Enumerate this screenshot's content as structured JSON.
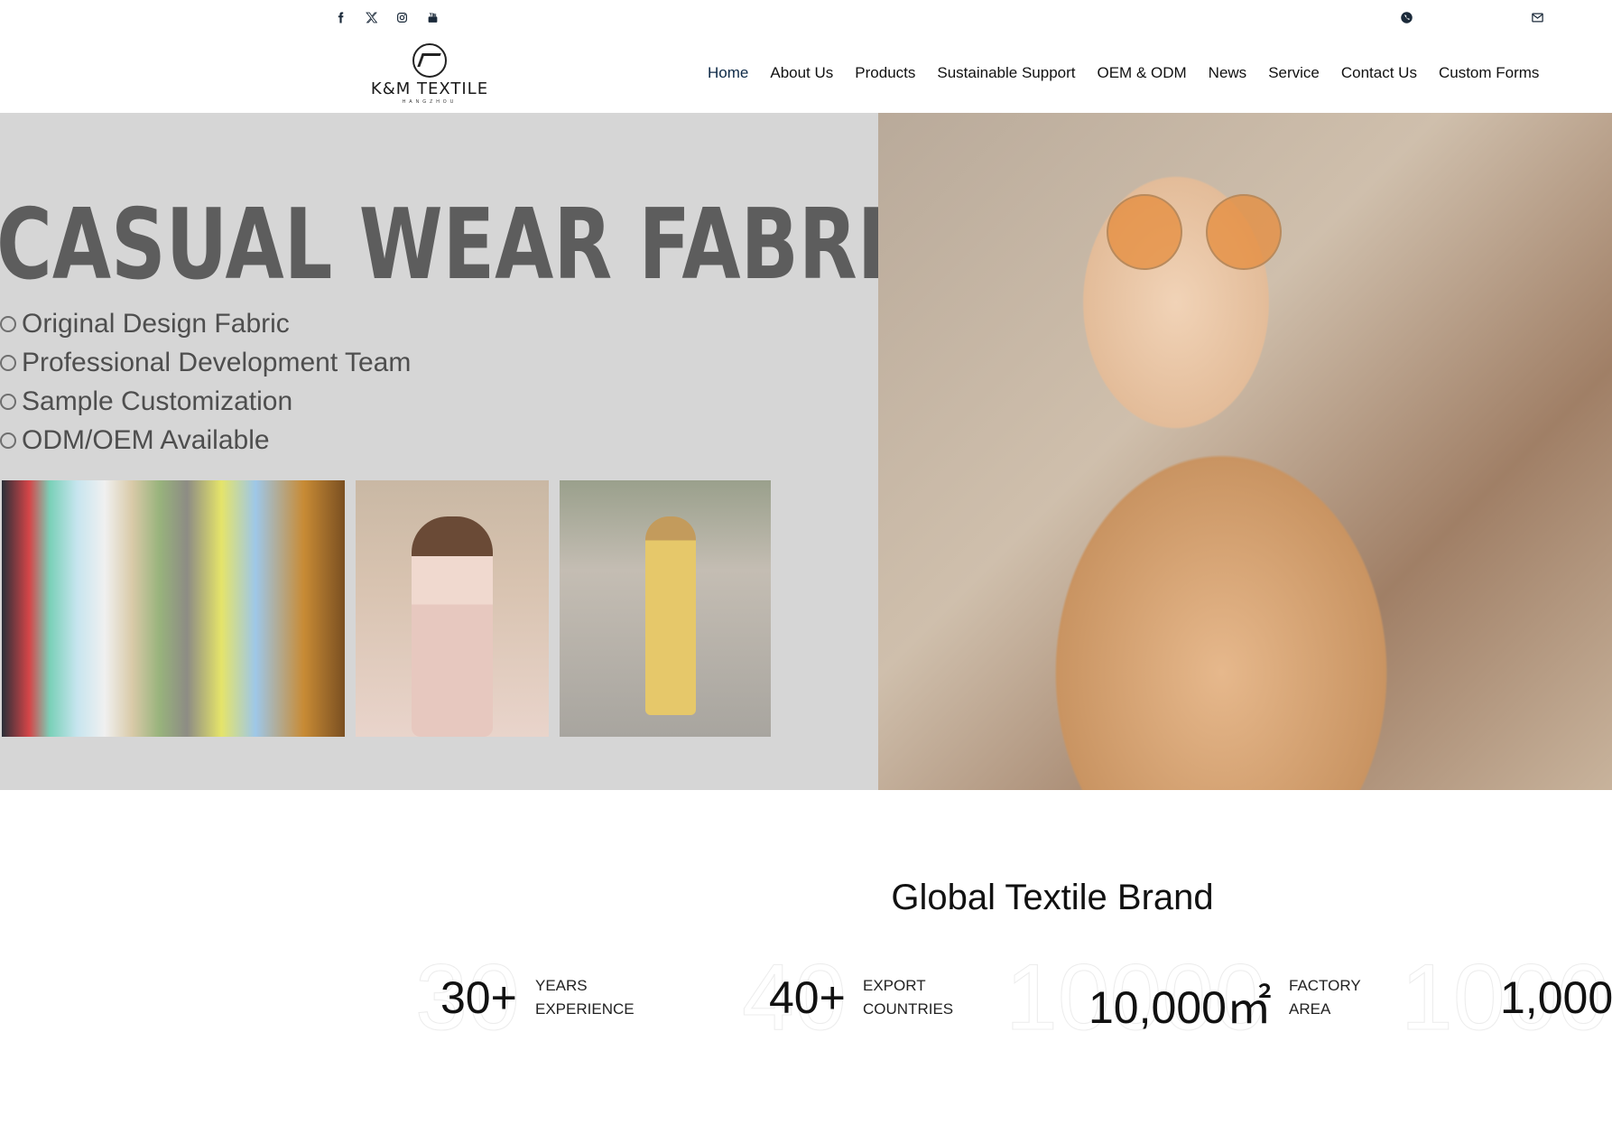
{
  "social_icons": [
    "facebook-icon",
    "x-icon",
    "instagram-icon",
    "youtube-icon"
  ],
  "contact_icons": [
    "whatsapp-icon",
    "mail-icon"
  ],
  "logo": {
    "brand": "K&M TEXTILE",
    "sub": "HANGZHOU"
  },
  "nav": [
    {
      "label": "Home",
      "active": true
    },
    {
      "label": "About Us"
    },
    {
      "label": "Products"
    },
    {
      "label": "Sustainable Support"
    },
    {
      "label": "OEM & ODM"
    },
    {
      "label": "News"
    },
    {
      "label": "Service"
    },
    {
      "label": "Contact Us"
    },
    {
      "label": "Custom Forms"
    }
  ],
  "hero": {
    "title": "CASUAL WEAR FABRIC",
    "features": [
      "Original Design Fabric",
      "Professional Development Team",
      "Sample Customization",
      "ODM/OEM Available"
    ]
  },
  "stats_section": {
    "title": "Global Textile Brand",
    "stats": [
      {
        "ghost": "30",
        "value": "30+",
        "label_line1": "YEARS",
        "label_line2": "EXPERIENCE"
      },
      {
        "ghost": "40",
        "value": "40+",
        "label_line1": "EXPORT",
        "label_line2": "COUNTRIES"
      },
      {
        "ghost": "10000",
        "value": "10,000㎡",
        "label_line1": "FACTORY",
        "label_line2": "AREA"
      },
      {
        "ghost": "1000",
        "value": "1,000",
        "label_line1": "",
        "label_line2": ""
      }
    ]
  },
  "colors": {
    "nav_active": "#0e2a47",
    "hero_bg": "#d6d6d6",
    "hero_title": "#5d5d5d"
  }
}
